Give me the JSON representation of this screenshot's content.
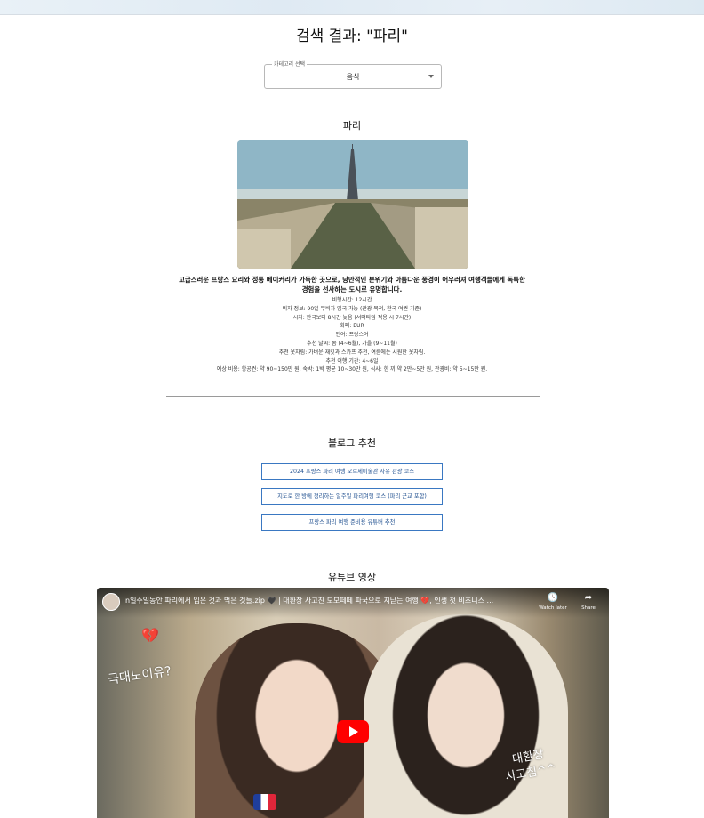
{
  "header": {
    "title": "검색 결과: \"파리\""
  },
  "category_select": {
    "legend": "카테고리 선택",
    "value": "음식",
    "icon": "chevron-down-icon"
  },
  "city": {
    "name": "파리",
    "description": "고급스러운 프랑스 요리와 정통 베이커리가 가득한 곳으로, 낭만적인 분위기와 아름다운 풍경이 어우러져 여행객들에게 독특한 경험을 선사하는 도시로 유명합니다.",
    "info": [
      "비행시간: 12시간",
      "비자 정보: 90일 무비자 입국 가능 (관광 목적, 한국 여권 기준)",
      "시차: 한국보다 8시간 늦음 (서머타임 적용 시 7시간)",
      "화폐: EUR",
      "언어: 프랑스어",
      "추천 날씨: 봄 (4~6월), 가을 (9~11월)",
      "추천 옷차림: 가벼운 재킷과 스카프 추천, 여름에는 시원한 옷차림.",
      "추천 여행 기간: 4~6일",
      "예상 비용: 항공권: 약 90~150만 원, 숙박: 1박 평균 10~30만 원, 식사: 한 끼 약 2만~5만 원, 관광비: 약 5~15만 원."
    ]
  },
  "blog": {
    "title": "블로그 추천",
    "items": [
      "2024 프랑스 파리 여행 오르세미술관 자유 관광 코스",
      "지도로 한 방에 정리하는 일주일 파리여행 코스 (파리 근교 포함)",
      "프랑스 파리 여행 준비용 유튜버 추천"
    ]
  },
  "youtube": {
    "title": "유튜브 영상",
    "video_title": "n일주일동안 파리에서 입은 것과 먹은 것들.zip 🖤 | 대환장 사고친 도모떼떼 파국으로 치닫는 여행 💔, 인생 첫 비즈니스 ...",
    "watch_later": "Watch later",
    "share": "Share",
    "overlay_left": "극대노이유?",
    "overlay_right": "대환장\n사고침^^"
  }
}
